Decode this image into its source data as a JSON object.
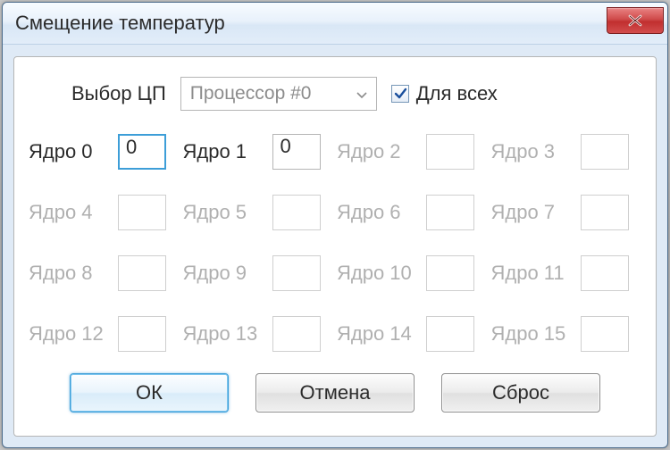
{
  "window": {
    "title": "Смещение температур"
  },
  "top": {
    "cpu_label": "Выбор ЦП",
    "cpu_selected": "Процессор #0",
    "for_all_label": "Для всех",
    "for_all_checked": true
  },
  "core_label_prefix": "Ядро",
  "cores": [
    {
      "idx": 0,
      "label": "Ядро 0",
      "value": "0",
      "enabled": true,
      "focused": true
    },
    {
      "idx": 1,
      "label": "Ядро 1",
      "value": "0",
      "enabled": true,
      "focused": false
    },
    {
      "idx": 2,
      "label": "Ядро 2",
      "value": "",
      "enabled": false,
      "focused": false
    },
    {
      "idx": 3,
      "label": "Ядро 3",
      "value": "",
      "enabled": false,
      "focused": false
    },
    {
      "idx": 4,
      "label": "Ядро 4",
      "value": "",
      "enabled": false,
      "focused": false
    },
    {
      "idx": 5,
      "label": "Ядро 5",
      "value": "",
      "enabled": false,
      "focused": false
    },
    {
      "idx": 6,
      "label": "Ядро 6",
      "value": "",
      "enabled": false,
      "focused": false
    },
    {
      "idx": 7,
      "label": "Ядро 7",
      "value": "",
      "enabled": false,
      "focused": false
    },
    {
      "idx": 8,
      "label": "Ядро 8",
      "value": "",
      "enabled": false,
      "focused": false
    },
    {
      "idx": 9,
      "label": "Ядро 9",
      "value": "",
      "enabled": false,
      "focused": false
    },
    {
      "idx": 10,
      "label": "Ядро 10",
      "value": "",
      "enabled": false,
      "focused": false
    },
    {
      "idx": 11,
      "label": "Ядро 11",
      "value": "",
      "enabled": false,
      "focused": false
    },
    {
      "idx": 12,
      "label": "Ядро 12",
      "value": "",
      "enabled": false,
      "focused": false
    },
    {
      "idx": 13,
      "label": "Ядро 13",
      "value": "",
      "enabled": false,
      "focused": false
    },
    {
      "idx": 14,
      "label": "Ядро 14",
      "value": "",
      "enabled": false,
      "focused": false
    },
    {
      "idx": 15,
      "label": "Ядро 15",
      "value": "",
      "enabled": false,
      "focused": false
    }
  ],
  "buttons": {
    "ok": "ОК",
    "cancel": "Отмена",
    "reset": "Сброс"
  }
}
